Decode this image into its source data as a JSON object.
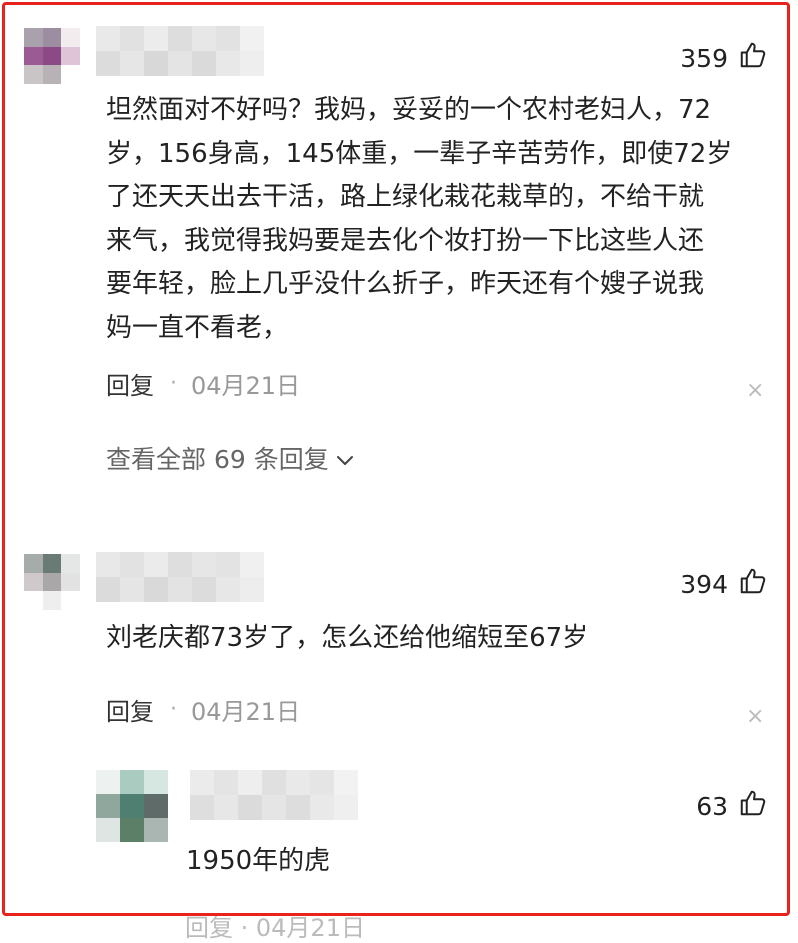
{
  "comments": [
    {
      "likes": "359",
      "text": "坦然面对不好吗？我妈，妥妥的一个农村老妇人，72\n岁，156身高，145体重，一辈子辛苦劳作，即使72岁\n了还天天出去干活，路上绿化栽花栽草的，不给干就\n来气，我觉得我妈要是去化个妆打扮一下比这些人还\n要年轻，脸上几乎没什么折子，昨天还有个嫂子说我\n妈一直不看老，",
      "reply_label": "回复",
      "separator": "·",
      "date": "04月21日",
      "close_glyph": "×",
      "view_all": "查看全部 69 条回复"
    },
    {
      "likes": "394",
      "text": "刘老庆都73岁了，怎么还给他缩短至67岁",
      "reply_label": "回复",
      "separator": "·",
      "date": "04月21日",
      "close_glyph": "×"
    }
  ],
  "sub_reply": {
    "likes": "63",
    "text": "1950年的虎"
  },
  "cut_off_meta": "回复  ·  04月21日",
  "colors": {
    "frame": "#e8231d",
    "text": "#222222",
    "meta": "#999999",
    "link": "#666666"
  },
  "icons": [
    "thumbs-up-icon",
    "close-icon",
    "chevron-down-icon"
  ]
}
